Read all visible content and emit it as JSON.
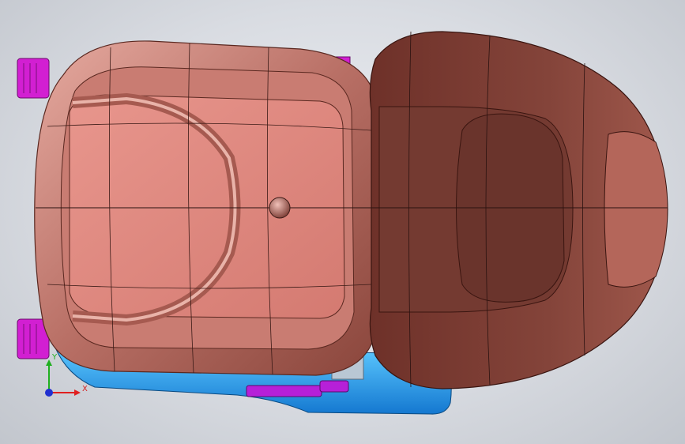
{
  "viewport": {
    "background_color": "#dcdfe4",
    "model": "car-seat-assembly"
  },
  "triad": {
    "x_label": "X",
    "y_label": "Y",
    "x_color": "#e02020",
    "y_color": "#20b020",
    "z_color": "#2030d0"
  },
  "colors": {
    "seat_shell": "#b56e64",
    "seat_shell_highlight": "#e3a79c",
    "seat_cushion": "#d9847b",
    "backrest": "#7d3d33",
    "base_frame": "#2aa3f0",
    "brackets": "#cc22cc"
  }
}
